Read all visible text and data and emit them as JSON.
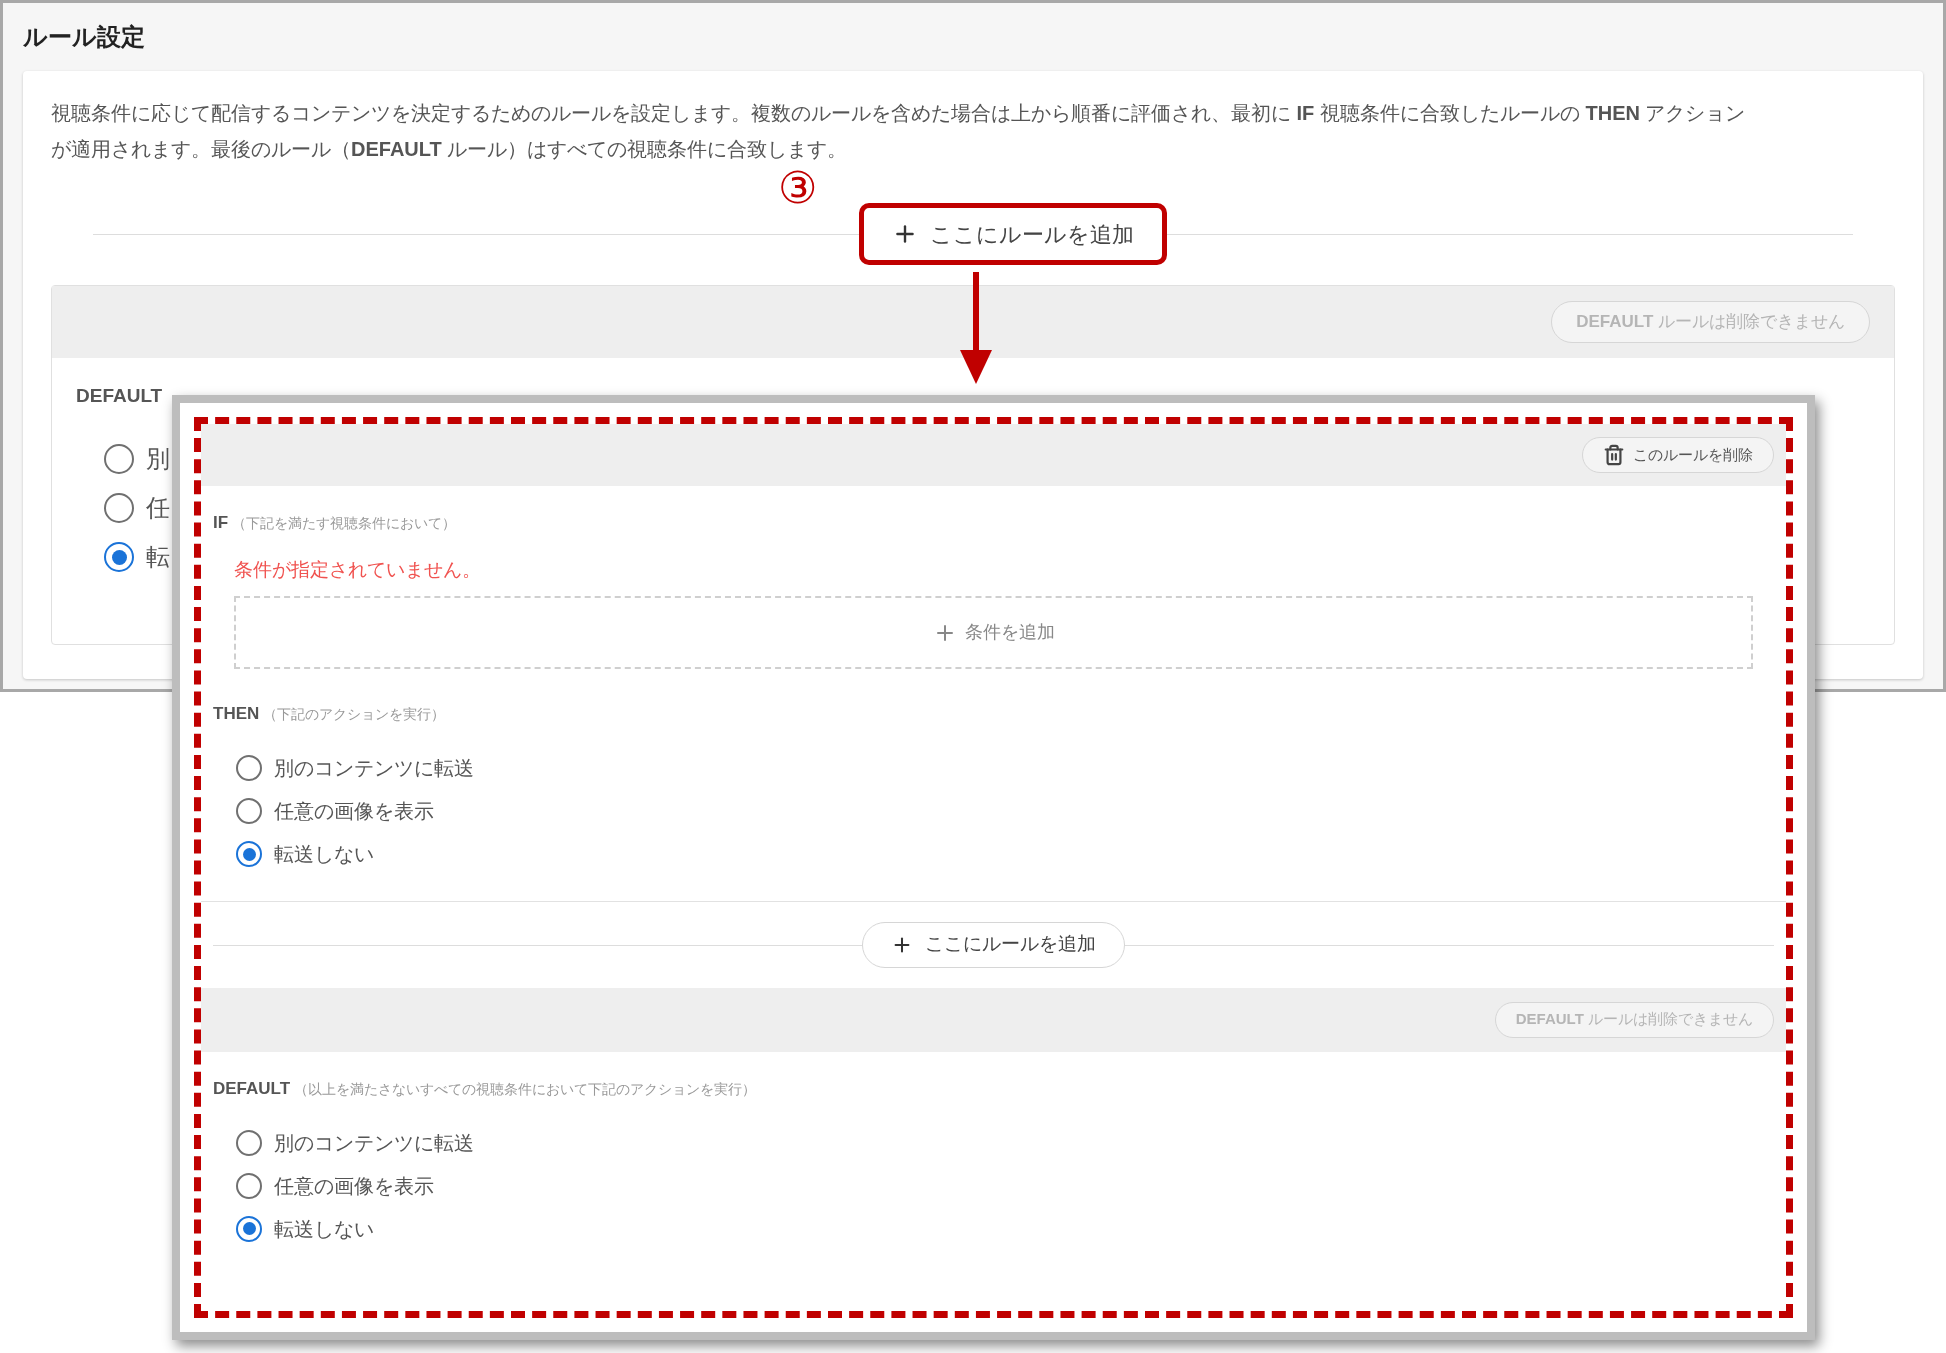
{
  "page_title": "ルール設定",
  "description": "視聴条件に応じて配信するコンテンツを決定するためのルールを設定します。複数のルールを含めた場合は上から順番に評価され、最初に **IF** 視聴条件に合致したルールの **THEN** アクションが適用されます。最後のルール（**DEFAULT** ルール）はすべての視聴条件に合致します。",
  "annotation": {
    "number": "③"
  },
  "add_rule_button": {
    "label": "ここにルールを追加",
    "highlighted": true
  },
  "default_rule": {
    "delete_button": {
      "label": "**DEFAULT** ルールは削除できません",
      "disabled": true
    },
    "label": "DEFAULT",
    "options": [
      {
        "label": "別",
        "selected": false
      },
      {
        "label": "任",
        "selected": false
      },
      {
        "label": "転",
        "selected": true
      }
    ]
  },
  "zoom_view": {
    "new_rule": {
      "delete_button": {
        "label": "このルールを削除",
        "disabled": false
      },
      "if_label": "IF",
      "if_hint": "（下記を満たす視聴条件において）",
      "error": "条件が指定されていません。",
      "add_condition": "条件を追加",
      "then_label": "THEN",
      "then_hint": "（下記のアクションを実行）",
      "options": [
        {
          "label": "別のコンテンツに転送",
          "selected": false
        },
        {
          "label": "任意の画像を表示",
          "selected": false
        },
        {
          "label": "転送しない",
          "selected": true
        }
      ]
    },
    "add_rule_button": {
      "label": "ここにルールを追加",
      "highlighted": false
    },
    "default_rule": {
      "delete_button": {
        "label": "**DEFAULT** ルールは削除できません",
        "disabled": true
      },
      "label": "DEFAULT",
      "hint": "（以上を満たさないすべての視聴条件において下記のアクションを実行）",
      "options": [
        {
          "label": "別のコンテンツに転送",
          "selected": false
        },
        {
          "label": "任意の画像を表示",
          "selected": false
        },
        {
          "label": "転送しない",
          "selected": true
        }
      ]
    }
  }
}
